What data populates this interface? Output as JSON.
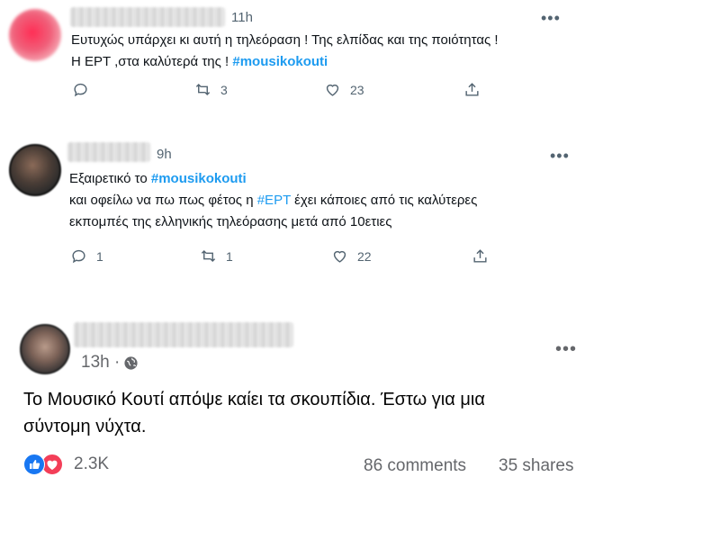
{
  "tweet1": {
    "time": "11h",
    "line1": "Ευτυχώς υπάρχει κι αυτή η τηλεόραση ! Της ελπίδας και της ποιότητας !",
    "line2_prefix": "Η ΕΡΤ ,στα καλύτερά της ! ",
    "hashtag": "#mousikokouti",
    "reply_icon": "reply-icon",
    "retweets": "3",
    "likes": "23",
    "more_label": "•••"
  },
  "tweet2": {
    "time": "9h",
    "line1_prefix": "Εξαιρετικό το ",
    "hashtag1": "#mousikokouti",
    "line2_prefix": "και οφείλω να πω πως φέτος η ",
    "hashtag2": "#ΕΡΤ",
    "line2_suffix": " έχει κάποιες από τις καλύτερες",
    "line3": "εκπομπές της ελληνικής τηλεόρασης μετά από 10ετιες",
    "replies": "1",
    "retweets": "1",
    "likes": "22",
    "more_label": "•••"
  },
  "fb_post": {
    "time": "13h ·",
    "line1": "Το Μουσικό Κουτί απόψε καίει τα σκουπίδια. Έστω για μια",
    "line2": "σύντομη νύχτα.",
    "reactions_count": "2.3K",
    "comments": "86 comments",
    "shares": "35 shares",
    "more_label": "•••"
  },
  "colors": {
    "twitter_blue": "#1d9bf0",
    "fb_like_blue": "#1877f2",
    "fb_love_red": "#f33e58",
    "muted": "#536471"
  }
}
